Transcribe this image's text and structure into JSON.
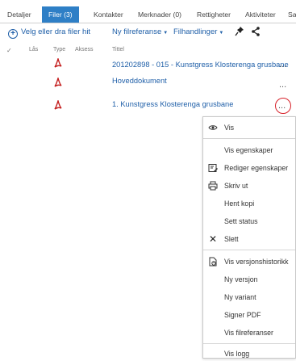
{
  "tabs": [
    {
      "label": "Detaljer"
    },
    {
      "label": "Filer (3)"
    },
    {
      "label": "Kontakter"
    },
    {
      "label": "Merknader (0)"
    },
    {
      "label": "Rettigheter"
    },
    {
      "label": "Aktiviteter"
    },
    {
      "label": "Sak"
    }
  ],
  "toolbar": {
    "pick_files": "Velg eller dra filer hit",
    "new_ref": "Ny filreferanse",
    "file_actions": "Filhandlinger",
    "pin_icon": "pin-icon",
    "share_icon": "share-icon"
  },
  "headers": {
    "check": "✓",
    "lock": "Lås",
    "type": "Type",
    "access": "Aksess",
    "title": "Tittel"
  },
  "rows": [
    {
      "title": "201202898 - 015 - Kunstgress Klosterenga grusbane",
      "type_icon": "pdf-icon"
    },
    {
      "title": "Hoveddokument",
      "type_icon": "pdf-icon"
    },
    {
      "title": "1. Kunstgress Klosterenga grusbane",
      "type_icon": "pdf-icon"
    }
  ],
  "more": "...",
  "menu": {
    "items": [
      {
        "label": "Vis",
        "icon": "eye-icon"
      },
      {
        "label": "Vis egenskaper"
      },
      {
        "label": "Rediger egenskaper",
        "icon": "edit-properties-icon"
      },
      {
        "label": "Skriv ut",
        "icon": "printer-icon"
      },
      {
        "label": "Hent kopi"
      },
      {
        "label": "Sett status"
      },
      {
        "label": "Slett",
        "icon": "delete-x-icon"
      },
      {
        "label": "Vis versjonshistorikk",
        "icon": "version-history-icon"
      },
      {
        "label": "Ny versjon"
      },
      {
        "label": "Ny variant"
      },
      {
        "label": "Signer PDF"
      },
      {
        "label": "Vis filreferanser"
      },
      {
        "label": "Vis logg"
      }
    ]
  },
  "colors": {
    "accent": "#2e7fc6",
    "link": "#1f5fa8",
    "highlight": "#d7222a"
  }
}
